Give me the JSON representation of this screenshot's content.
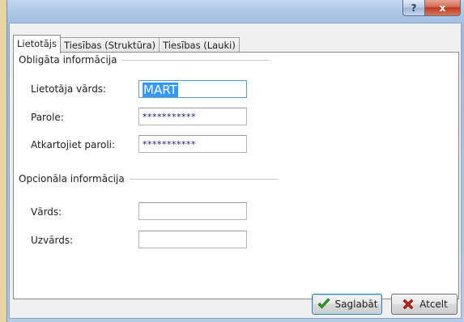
{
  "window": {
    "help_label": "?",
    "close_label": "x"
  },
  "tabs": [
    {
      "label": "Lietotājs",
      "active": true
    },
    {
      "label": "Tiesības (Struktūra)",
      "active": false
    },
    {
      "label": "Tiesības (Lauki)",
      "active": false
    }
  ],
  "required_group": {
    "title": "Obligāta informācija",
    "username_label": "Lietotāja vārds:",
    "username_value": "MART",
    "password_label": "Parole:",
    "password_value": "***********",
    "repeat_label": "Atkartojiet paroli:",
    "repeat_value": "***********"
  },
  "optional_group": {
    "title": "Opcionāla informācija",
    "first_name_label": "Vārds:",
    "first_name_value": "",
    "last_name_label": "Uzvārds:",
    "last_name_value": ""
  },
  "buttons": {
    "save_label": "Saglabāt",
    "cancel_label": "Atcelt"
  },
  "colors": {
    "selection": "#3399ff",
    "save_check": "#2e9e2e",
    "cancel_x": "#c0201a"
  },
  "icons": {
    "save": "checkmark-icon",
    "cancel": "x-icon"
  }
}
